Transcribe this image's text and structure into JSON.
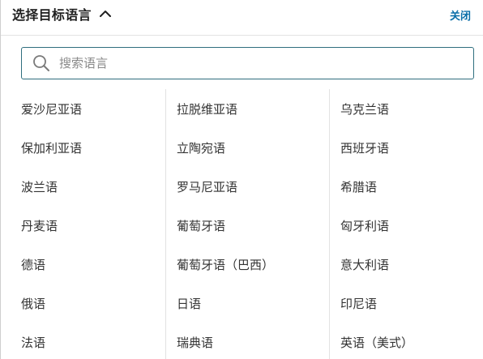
{
  "header": {
    "title": "选择目标语言",
    "close_label": "关闭"
  },
  "search": {
    "placeholder": "搜索语言",
    "value": ""
  },
  "icons": {
    "expand": "chevron-up-icon",
    "search": "search-icon"
  },
  "colors": {
    "accent": "#0a6ea8",
    "search_border": "#2f6e7e",
    "text": "#333333"
  },
  "columns": [
    {
      "items": [
        "爱沙尼亚语",
        "保加利亚语",
        "波兰语",
        "丹麦语",
        "德语",
        "俄语",
        "法语"
      ]
    },
    {
      "items": [
        "拉脱维亚语",
        "立陶宛语",
        "罗马尼亚语",
        "葡萄牙语",
        "葡萄牙语（巴西）",
        "日语",
        "瑞典语"
      ]
    },
    {
      "items": [
        "乌克兰语",
        "西班牙语",
        "希腊语",
        "匈牙利语",
        "意大利语",
        "印尼语",
        "英语（美式）"
      ]
    }
  ]
}
